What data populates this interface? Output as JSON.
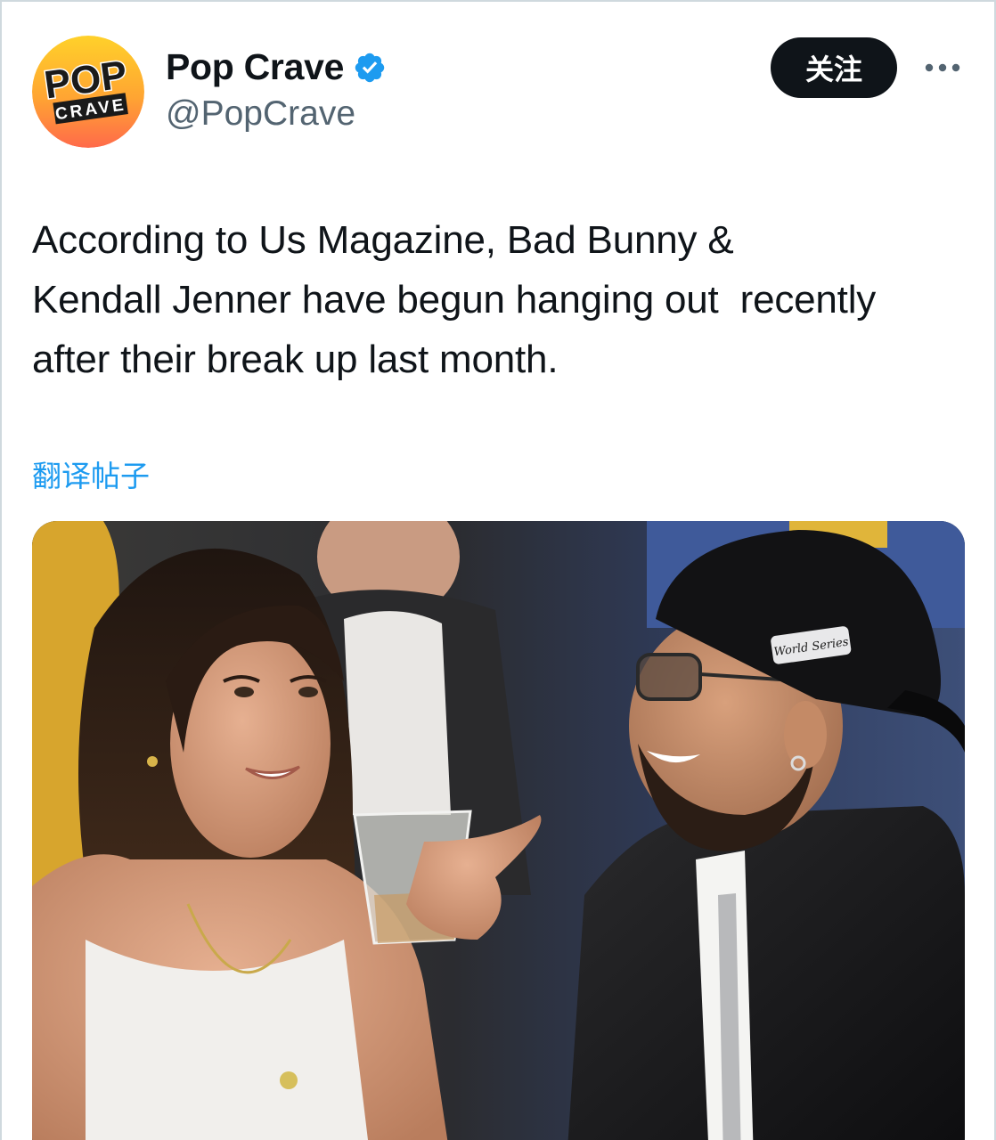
{
  "tweet": {
    "author": {
      "display_name": "Pop Crave",
      "handle": "@PopCrave",
      "verified": true,
      "avatar_text_top": "POP",
      "avatar_text_bottom": "CRAVE",
      "verified_icon": "verified-badge-icon"
    },
    "follow_label": "关注",
    "more_icon": "more-options-icon",
    "text_lines": [
      "According to Us Magazine, Bad Bunny &",
      "Kendall Jenner have begun hanging out  recently",
      "after their break up last month."
    ],
    "translate_label": "翻译帖子",
    "media": {
      "cap_patch_text": "World Series"
    }
  },
  "colors": {
    "link": "#1d9bf0",
    "text": "#0f1419",
    "secondary": "#536471",
    "follow_bg": "#0f1419",
    "verified": "#1d9bf0"
  }
}
